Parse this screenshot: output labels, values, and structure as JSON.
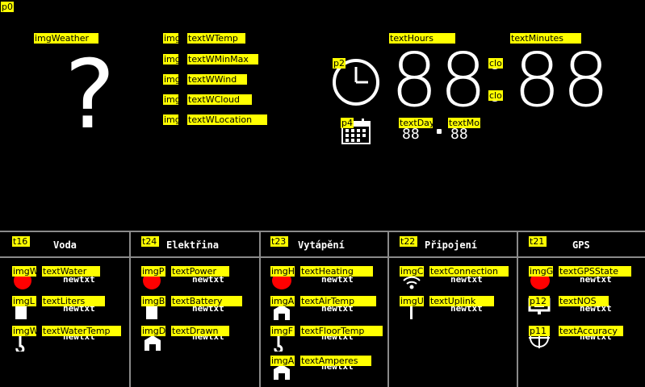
{
  "top": {
    "page_tag": "p0",
    "weather": {
      "img_tag": "imgWeather",
      "symbol": "?",
      "rows": [
        {
          "img_tag": "img",
          "text_tag": "textWTemp"
        },
        {
          "img_tag": "img",
          "text_tag": "textWMinMax"
        },
        {
          "img_tag": "img",
          "text_tag": "textWWind"
        },
        {
          "img_tag": "img",
          "text_tag": "textWCloud"
        },
        {
          "img_tag": "img",
          "text_tag": "textWLocation"
        }
      ]
    },
    "clock": {
      "clock_tag": "p2",
      "hours_tag": "textHours",
      "minutes_tag": "textMinutes",
      "hours": "88",
      "minutes": "88",
      "colon_top_tag": "clo",
      "colon_bottom_tag": "clo",
      "calendar_tag": "p4",
      "day_tag": "textDay",
      "month_tag": "textMor",
      "day": "88",
      "month": "88"
    }
  },
  "sections": [
    {
      "tag": "t16",
      "title": "Voda",
      "rows": [
        {
          "img_tag": "imgW",
          "text_tag": "textWater",
          "value": "newtxt",
          "icon": "red-drop-icon"
        },
        {
          "img_tag": "imgL",
          "text_tag": "textLiters",
          "value": "newtxt",
          "icon": "liters-icon"
        },
        {
          "img_tag": "imgW",
          "text_tag": "textWaterTemp",
          "value": "newtxt",
          "icon": "thermometer-icon"
        }
      ]
    },
    {
      "tag": "t24",
      "title": "Elektřina",
      "rows": [
        {
          "img_tag": "imgP",
          "text_tag": "textPower",
          "value": "newtxt",
          "icon": "power-icon"
        },
        {
          "img_tag": "imgB",
          "text_tag": "textBattery",
          "value": "newtxt",
          "icon": "battery-icon"
        },
        {
          "img_tag": "imgD",
          "text_tag": "textDrawn",
          "value": "newtxt",
          "icon": "drawn-icon"
        }
      ]
    },
    {
      "tag": "t23",
      "title": "Vytápění",
      "rows": [
        {
          "img_tag": "imgH",
          "text_tag": "textHeating",
          "value": "newtxt",
          "icon": "heating-icon"
        },
        {
          "img_tag": "imgA",
          "text_tag": "textAirTemp",
          "value": "newtxt",
          "icon": "air-temp-icon"
        },
        {
          "img_tag": "imgF",
          "text_tag": "textFloorTemp",
          "value": "newtxt",
          "icon": "floor-temp-icon"
        },
        {
          "img_tag": "imgA",
          "text_tag": "textAmperes",
          "value": "newtxt",
          "icon": "amperes-icon"
        }
      ]
    },
    {
      "tag": "t22",
      "title": "Připojení",
      "rows": [
        {
          "img_tag": "imgC",
          "text_tag": "textConnection",
          "value": "newtxt",
          "icon": "wifi-icon"
        },
        {
          "img_tag": "imgU",
          "text_tag": "textUplink",
          "value": "newtxt",
          "icon": "uplink-icon"
        }
      ]
    },
    {
      "tag": "t21",
      "title": "GPS",
      "rows": [
        {
          "img_tag": "imgG",
          "text_tag": "textGPSState",
          "value": "newtxt",
          "icon": "gps-state-icon"
        },
        {
          "img_tag": "p12",
          "text_tag": "textNOS",
          "value": "newtxt",
          "icon": "satellite-dish-icon"
        },
        {
          "img_tag": "p11",
          "text_tag": "textAccuracy",
          "value": "newtxt",
          "icon": "accuracy-icon"
        }
      ]
    }
  ],
  "colors": {
    "tag_bg": "#ffff00",
    "accent_red": "#ff0000",
    "divider": "#8a8a8a",
    "bg": "#000000"
  }
}
